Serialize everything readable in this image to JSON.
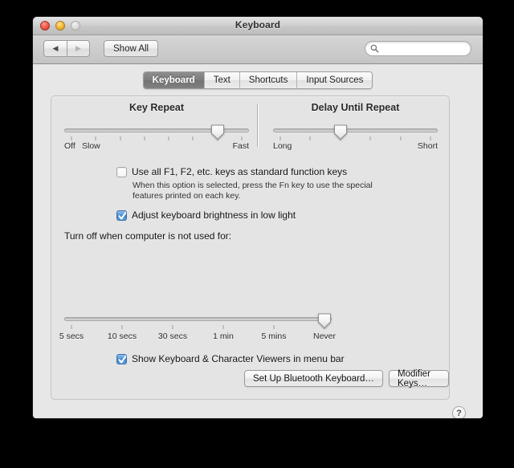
{
  "window": {
    "title": "Keyboard",
    "traffic": {
      "close": "close-button",
      "minimize": "minimize-button",
      "zoom": "zoom-button"
    }
  },
  "toolbar": {
    "back_glyph": "◀",
    "forward_glyph": "▶",
    "show_all_label": "Show All",
    "search": {
      "value": "",
      "placeholder": ""
    }
  },
  "tabs": [
    {
      "label": "Keyboard",
      "selected": true
    },
    {
      "label": "Text",
      "selected": false
    },
    {
      "label": "Shortcuts",
      "selected": false
    },
    {
      "label": "Input Sources",
      "selected": false
    }
  ],
  "key_repeat": {
    "title": "Key Repeat",
    "ticks": 8,
    "value_index": 6,
    "labels": {
      "off": "Off",
      "min": "Slow",
      "max": "Fast"
    }
  },
  "delay_until_repeat": {
    "title": "Delay Until Repeat",
    "ticks": 6,
    "value_index": 2,
    "labels": {
      "min": "Long",
      "max": "Short"
    }
  },
  "function_keys": {
    "checked": false,
    "label": "Use all F1, F2, etc. keys as standard function keys",
    "help": "When this option is selected, press the Fn key to use the special features printed on each key."
  },
  "brightness": {
    "checked": true,
    "label": "Adjust keyboard brightness in low light"
  },
  "turn_off": {
    "label": "Turn off when computer is not used for:",
    "options": [
      "5 secs",
      "10 secs",
      "30 secs",
      "1 min",
      "5 mins",
      "Never"
    ],
    "selected_index": 5
  },
  "viewers": {
    "checked": true,
    "label": "Show Keyboard & Character Viewers in menu bar"
  },
  "buttons": {
    "bluetooth": "Set Up Bluetooth Keyboard…",
    "modifier_keys": "Modifier Keys…",
    "help": "?"
  }
}
